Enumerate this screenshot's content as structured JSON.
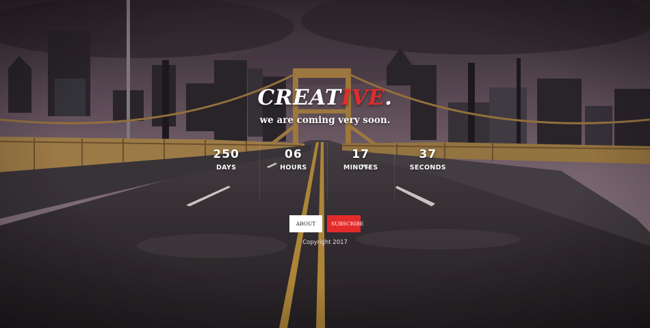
{
  "brand": {
    "part1": "CREAT",
    "part2": "IVE",
    "part3": "."
  },
  "tagline": "we are coming very soon.",
  "countdown": [
    {
      "value": "250",
      "label": "DAYS"
    },
    {
      "value": "06",
      "label": "HOURS"
    },
    {
      "value": "17",
      "label": "MINUTES"
    },
    {
      "value": "37",
      "label": "SECONDS"
    }
  ],
  "buttons": {
    "about": "ABOUT US",
    "subscribe": "SUBSCRIBE"
  },
  "footer": {
    "copyright": "Copyright 2017"
  },
  "colors": {
    "accent": "#e32b2b",
    "text": "#ffffff",
    "road": "#2b2829",
    "bridge": "#c49a4c"
  }
}
